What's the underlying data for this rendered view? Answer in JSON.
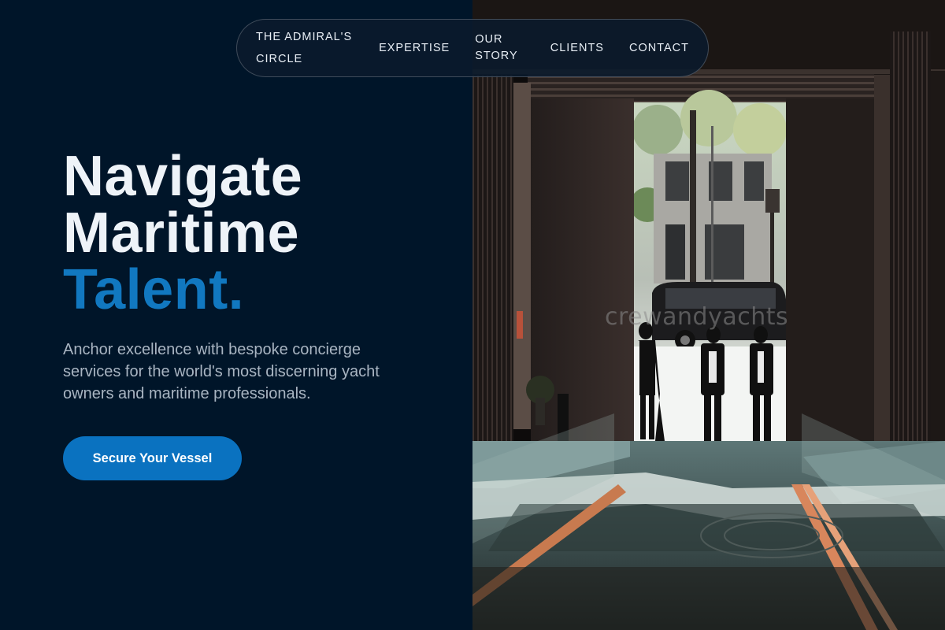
{
  "nav": {
    "brand": "THE ADMIRAL'S CIRCLE",
    "items": [
      {
        "label": "EXPERTISE"
      },
      {
        "label": "OUR STORY"
      },
      {
        "label": "CLIENTS"
      },
      {
        "label": "CONTACT"
      }
    ]
  },
  "hero": {
    "title_line1": "Navigate",
    "title_line2": "Maritime",
    "title_accent": "Talent.",
    "description": "Anchor excellence with bespoke concierge services for the world's most discerning yacht owners and maritime professionals.",
    "cta_label": "Secure Your Vessel"
  },
  "image": {
    "watermark": "crewandyachts",
    "subject": "people-silhouettes-in-building-entrance"
  },
  "colors": {
    "background": "#001529",
    "accent": "#1178c0",
    "button": "#0a72c0",
    "text_primary": "#eef3f8",
    "text_secondary": "#a9b5c2"
  }
}
